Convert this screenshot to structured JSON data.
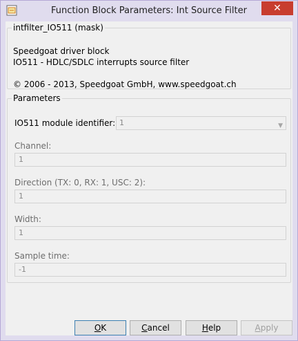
{
  "window": {
    "title": "Function Block Parameters: Int Source Filter",
    "close_glyph": "✕"
  },
  "mask": {
    "title": "intfilter_IO511 (mask)",
    "desc_line1": "Speedgoat driver block",
    "desc_line2": "IO511 - HDLC/SDLC interrupts source filter",
    "copyright": "© 2006 - 2013, Speedgoat GmbH, www.speedgoat.ch"
  },
  "parameters": {
    "title": "Parameters",
    "module_id_label": "IO511 module identifier:",
    "module_id_value": "1",
    "channel_label": "Channel:",
    "channel_value": "1",
    "direction_label": "Direction (TX: 0, RX: 1, USC: 2):",
    "direction_value": "1",
    "width_label": "Width:",
    "width_value": "1",
    "sample_time_label": "Sample time:",
    "sample_time_value": "-1"
  },
  "buttons": {
    "ok": {
      "first": "O",
      "rest": "K"
    },
    "cancel": {
      "first": "C",
      "rest": "ancel"
    },
    "help": {
      "first": "H",
      "rest": "elp"
    },
    "apply": {
      "first": "A",
      "rest": "pply"
    }
  },
  "icons": {
    "app": "simulink-block-icon",
    "dropdown": "chevron-down-icon"
  },
  "colors": {
    "window_frame": "#e0dcee",
    "close_button": "#c83d2e",
    "client_bg": "#f0f0f0",
    "disabled_text": "#888888"
  }
}
